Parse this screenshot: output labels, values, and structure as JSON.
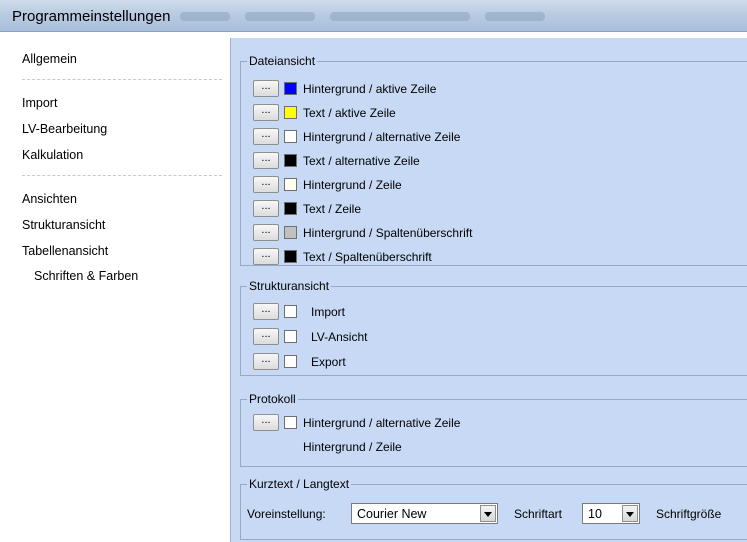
{
  "window": {
    "title": "Programmeinstellungen"
  },
  "sidebar": {
    "items": [
      {
        "label": "Allgemein"
      },
      {
        "label": "Import"
      },
      {
        "label": "LV-Bearbeitung"
      },
      {
        "label": "Kalkulation"
      },
      {
        "label": "Ansichten"
      },
      {
        "label": "Strukturansicht"
      },
      {
        "label": "Tabellenansicht"
      },
      {
        "label": "Schriften & Farben"
      }
    ]
  },
  "button_label": "...",
  "dateiansicht": {
    "title": "Dateiansicht",
    "rows": [
      {
        "label": "Hintergrund / aktive Zeile",
        "color": "#0000ff"
      },
      {
        "label": "Text / aktive Zeile",
        "color": "#ffff00"
      },
      {
        "label": "Hintergrund / alternative Zeile",
        "color": "#ffffff"
      },
      {
        "label": "Text / alternative Zeile",
        "color": "#000000"
      },
      {
        "label": "Hintergrund / Zeile",
        "color": "#fffff0"
      },
      {
        "label": "Text / Zeile",
        "color": "#000000"
      },
      {
        "label": "Hintergrund / Spaltenüberschrift",
        "color": "#c0c0c0"
      },
      {
        "label": "Text / Spaltenüberschrift",
        "color": "#000000"
      }
    ]
  },
  "strukturansicht": {
    "title": "Strukturansicht",
    "rows": [
      {
        "label": "Import",
        "color": "#ffffff"
      },
      {
        "label": "LV-Ansicht",
        "color": "#ffffff"
      },
      {
        "label": "Export",
        "color": "#ffffff"
      }
    ]
  },
  "protokoll": {
    "title": "Protokoll",
    "rows": [
      {
        "label": "Hintergrund / alternative Zeile",
        "color": "#ffffff"
      }
    ],
    "extra_label": "Hintergrund / Zeile"
  },
  "kurztext": {
    "title": "Kurztext / Langtext",
    "preset_label": "Voreinstellung:",
    "font_value": "Courier New",
    "font_label": "Schriftart",
    "size_value": "10",
    "size_label": "Schriftgröße"
  }
}
